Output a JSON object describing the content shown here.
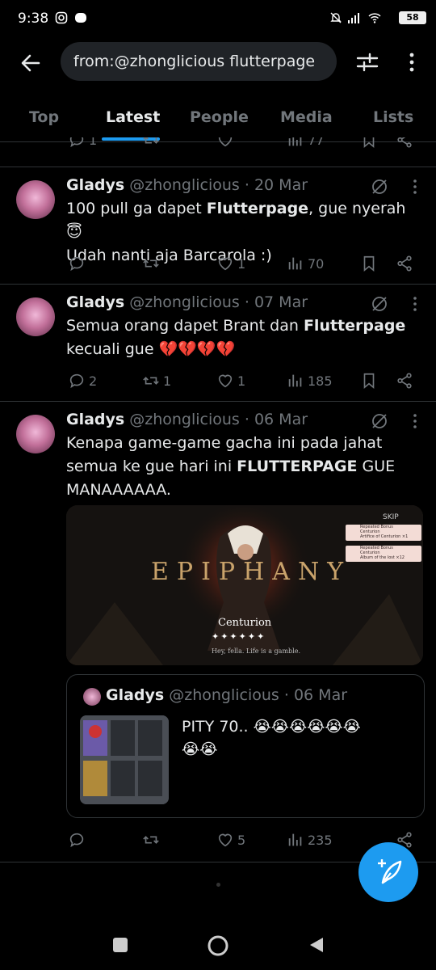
{
  "status": {
    "time": "9:38",
    "battery": "58"
  },
  "search": {
    "query": "from:@zhonglicious flutterpage"
  },
  "tabs": [
    "Top",
    "Latest",
    "People",
    "Media",
    "Lists"
  ],
  "top_stub": {
    "replies": "1",
    "views": "77"
  },
  "tweets": [
    {
      "name": "Gladys",
      "handle": "@zhonglicious",
      "date": "· 20 Mar",
      "line1_pre": "100 pull ga dapet ",
      "line1_bold": "Flutterpage",
      "line1_post": ", gue nyerah😇",
      "line2": "Udah nanti aja Barcarola :)",
      "replies": "",
      "retweets": "",
      "likes": "1",
      "views": "70"
    },
    {
      "name": "Gladys",
      "handle": "@zhonglicious",
      "date": "· 07 Mar",
      "line1_pre": "Semua orang dapet Brant dan ",
      "line1_bold": "Flutterpage",
      "line1_post": "",
      "line2": "kecuali gue 💔💔💔💔",
      "replies": "2",
      "retweets": "1",
      "likes": "1",
      "views": "185"
    },
    {
      "name": "Gladys",
      "handle": "@zhonglicious",
      "date": "· 06 Mar",
      "line1": "Kenapa game-game gacha ini pada jahat",
      "line2_pre": "semua ke gue hari ini ",
      "line2_bold": "FLUTTERPAGE",
      "line2_post": " GUE",
      "line3": "MANAAAAAA.",
      "media": {
        "title": "EPIPHANY",
        "character": "Centurion",
        "caption": "Hey, fella. Life is a gamble.",
        "skip": "SKIP",
        "reward1_title": "Repeated Bonus",
        "reward1_sub": "Centurion",
        "reward1_item": "Artifice of Centurion ×1",
        "reward2_title": "Repeated Bonus",
        "reward2_sub": "Centurion",
        "reward2_item": "Album of the lost ×12"
      },
      "quote": {
        "name": "Gladys",
        "handle": "@zhonglicious",
        "date": "· 06 Mar",
        "text1": "PITY 70.. 😭😭😭😭😭😭",
        "text2": "😭😭"
      },
      "replies": "",
      "retweets": "",
      "likes": "5",
      "views": "235"
    }
  ]
}
